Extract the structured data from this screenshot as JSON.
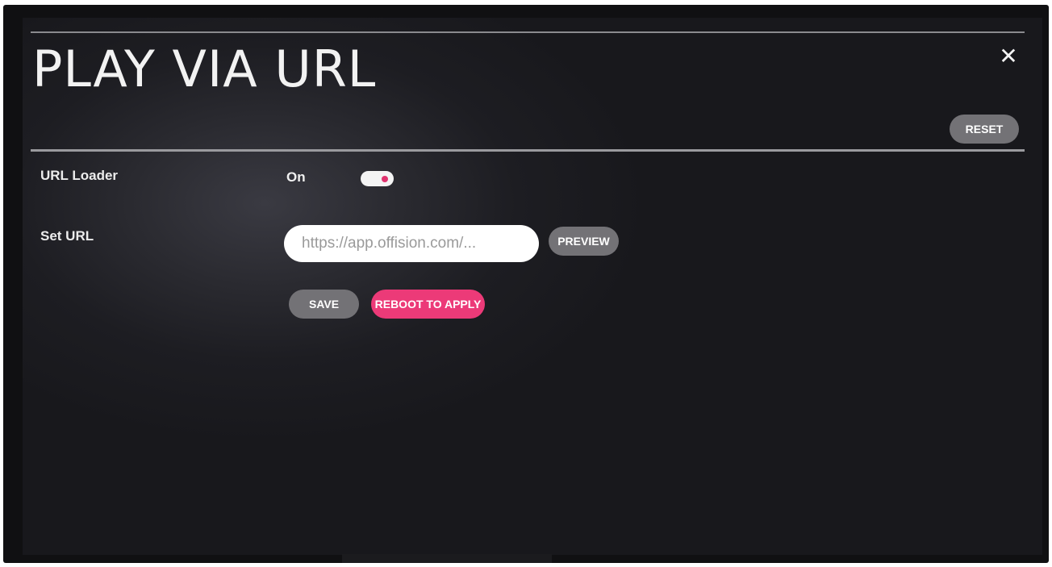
{
  "header": {
    "title": "PLAY VIA URL",
    "close_symbol": "✕",
    "reset_label": "RESET"
  },
  "settings": {
    "url_loader": {
      "label": "URL Loader",
      "value": "On",
      "enabled": true
    },
    "set_url": {
      "label": "Set URL",
      "input_value": "https://app.offision.com/...",
      "preview_label": "PREVIEW"
    }
  },
  "actions": {
    "save_label": "SAVE",
    "reboot_label": "REBOOT TO APPLY"
  },
  "colors": {
    "accent_pink": "#ec3a78",
    "button_gray": "#737276",
    "background": "#1d1d22"
  }
}
